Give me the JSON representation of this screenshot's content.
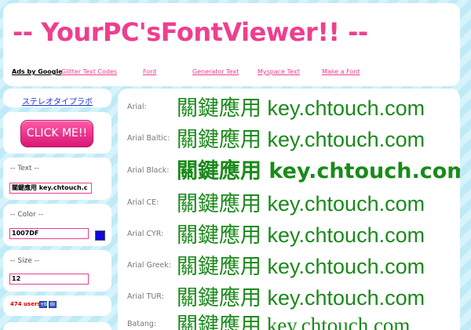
{
  "header": {
    "title": "-- YourPC'sFontViewer!! --",
    "ads_label": "Ads by Google",
    "nav_links": [
      "Glitter Text Codes",
      "Font",
      "Generator Text",
      "Myspace Text",
      "Make a Font"
    ]
  },
  "sidebar": {
    "font_select_label": "ステレオタイプラボ",
    "click_button_label": "CLICK ME!!",
    "text_section": {
      "title": "-- Text --",
      "value": "關鍵應用 key.chtouch.c"
    },
    "color_section": {
      "title": "-- Color --",
      "value": "1007DF",
      "swatch_color": "#1007DF"
    },
    "size_section": {
      "title": "-- Size --",
      "value": "12"
    },
    "users_label": "474 users",
    "mini_buttons": [
      "+B",
      "BI"
    ]
  },
  "preview": {
    "sample_color": "#1a8a1a",
    "sample_text": "關鍵應用 key.chtouch.com",
    "rows": [
      {
        "font": "Arial:",
        "weight": "normal",
        "family": "Liberation Sans"
      },
      {
        "font": "Arial Baltic:",
        "weight": "normal",
        "family": "Liberation Sans"
      },
      {
        "font": "Arial Black:",
        "weight": "bold",
        "family": "DejaVu Sans"
      },
      {
        "font": "Arial CE:",
        "weight": "normal",
        "family": "Liberation Sans"
      },
      {
        "font": "Arial CYR:",
        "weight": "normal",
        "family": "Liberation Sans"
      },
      {
        "font": "Arial Greek:",
        "weight": "normal",
        "family": "Liberation Sans"
      },
      {
        "font": "Arial TUR:",
        "weight": "normal",
        "family": "Liberation Sans"
      },
      {
        "font": "Batang:",
        "weight": "normal",
        "family": "Liberation Serif"
      }
    ]
  }
}
